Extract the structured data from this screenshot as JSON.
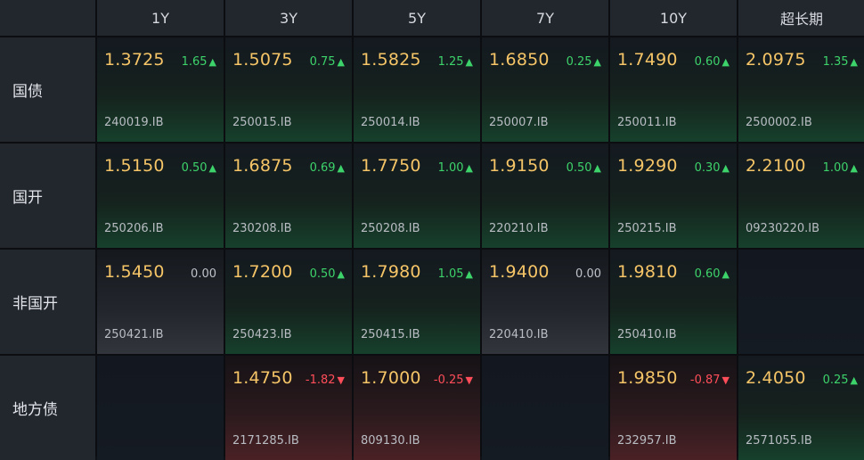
{
  "columns": [
    "1Y",
    "3Y",
    "5Y",
    "7Y",
    "10Y",
    "超长期"
  ],
  "rows": [
    {
      "label": "国债",
      "cells": [
        {
          "yield": "1.3725",
          "change": "1.65",
          "dir": "up",
          "code": "240019.IB"
        },
        {
          "yield": "1.5075",
          "change": "0.75",
          "dir": "up",
          "code": "250015.IB"
        },
        {
          "yield": "1.5825",
          "change": "1.25",
          "dir": "up",
          "code": "250014.IB"
        },
        {
          "yield": "1.6850",
          "change": "0.25",
          "dir": "up",
          "code": "250007.IB"
        },
        {
          "yield": "1.7490",
          "change": "0.60",
          "dir": "up",
          "code": "250011.IB"
        },
        {
          "yield": "2.0975",
          "change": "1.35",
          "dir": "up",
          "code": "2500002.IB"
        }
      ]
    },
    {
      "label": "国开",
      "cells": [
        {
          "yield": "1.5150",
          "change": "0.50",
          "dir": "up",
          "code": "250206.IB"
        },
        {
          "yield": "1.6875",
          "change": "0.69",
          "dir": "up",
          "code": "230208.IB"
        },
        {
          "yield": "1.7750",
          "change": "1.00",
          "dir": "up",
          "code": "250208.IB"
        },
        {
          "yield": "1.9150",
          "change": "0.50",
          "dir": "up",
          "code": "220210.IB"
        },
        {
          "yield": "1.9290",
          "change": "0.30",
          "dir": "up",
          "code": "250215.IB"
        },
        {
          "yield": "2.2100",
          "change": "1.00",
          "dir": "up",
          "code": "09230220.IB"
        }
      ]
    },
    {
      "label": "非国开",
      "cells": [
        {
          "yield": "1.5450",
          "change": "0.00",
          "dir": "flat",
          "code": "250421.IB"
        },
        {
          "yield": "1.7200",
          "change": "0.50",
          "dir": "up",
          "code": "250423.IB"
        },
        {
          "yield": "1.7980",
          "change": "1.05",
          "dir": "up",
          "code": "250415.IB"
        },
        {
          "yield": "1.9400",
          "change": "0.00",
          "dir": "flat",
          "code": "220410.IB"
        },
        {
          "yield": "1.9810",
          "change": "0.60",
          "dir": "up",
          "code": "250410.IB"
        },
        null
      ]
    },
    {
      "label": "地方债",
      "cells": [
        null,
        {
          "yield": "1.4750",
          "change": "-1.82",
          "dir": "down",
          "code": "2171285.IB"
        },
        {
          "yield": "1.7000",
          "change": "-0.25",
          "dir": "down",
          "code": "809130.IB"
        },
        null,
        {
          "yield": "1.9850",
          "change": "-0.87",
          "dir": "down",
          "code": "232957.IB"
        },
        {
          "yield": "2.4050",
          "change": "0.25",
          "dir": "up",
          "code": "2571055.IB"
        }
      ]
    }
  ],
  "arrows": {
    "up": "▲",
    "down": "▼",
    "flat": ""
  },
  "colors": {
    "yield": "#f5c567",
    "up": "#3dd36b",
    "down": "#ff4d5a",
    "flat": "#bfc3c9",
    "header_bg": "#22262d"
  }
}
